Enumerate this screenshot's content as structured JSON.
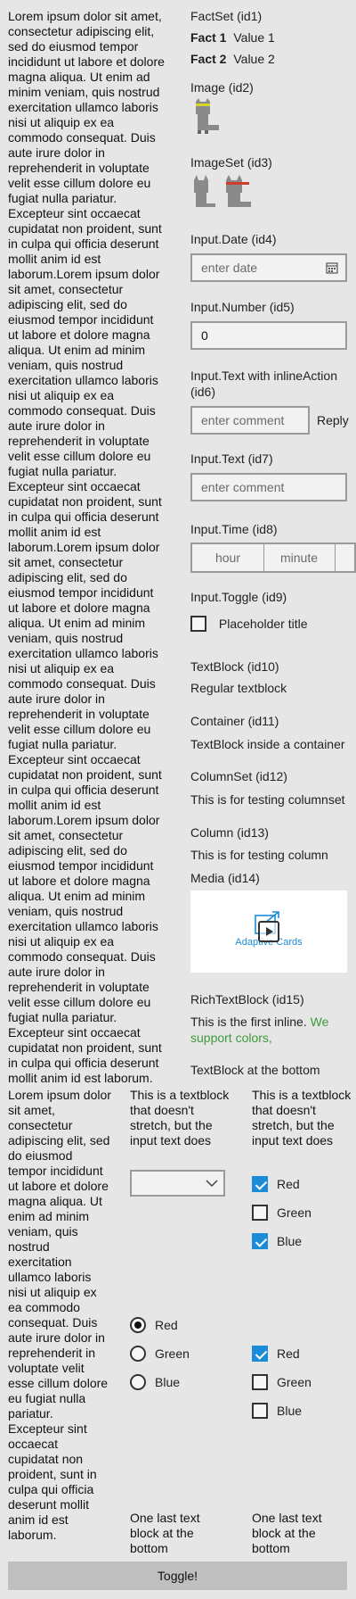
{
  "left_text": "Lorem ipsum dolor sit amet, consectetur adipiscing elit, sed do eiusmod tempor incididunt ut labore et dolore magna aliqua. Ut enim ad minim veniam, quis nostrud exercitation ullamco laboris nisi ut aliquip ex ea commodo consequat. Duis aute irure dolor in reprehenderit in voluptate velit esse cillum dolore eu fugiat nulla pariatur. Excepteur sint occaecat cupidatat non proident, sunt in culpa qui officia deserunt mollit anim id est laborum.Lorem ipsum dolor sit amet, consectetur adipiscing elit, sed do eiusmod tempor incididunt ut labore et dolore magna aliqua. Ut enim ad minim veniam, quis nostrud exercitation ullamco laboris nisi ut aliquip ex ea commodo consequat. Duis aute irure dolor in reprehenderit in voluptate velit esse cillum dolore eu fugiat nulla pariatur. Excepteur sint occaecat cupidatat non proident, sunt in culpa qui officia deserunt mollit anim id est laborum.Lorem ipsum dolor sit amet, consectetur adipiscing elit, sed do eiusmod tempor incididunt ut labore et dolore magna aliqua. Ut enim ad minim veniam, quis nostrud exercitation ullamco laboris nisi ut aliquip ex ea commodo consequat. Duis aute irure dolor in reprehenderit in voluptate velit esse cillum dolore eu fugiat nulla pariatur. Excepteur sint occaecat cupidatat non proident, sunt in culpa qui officia deserunt mollit anim id est laborum.Lorem ipsum dolor sit amet, consectetur adipiscing elit, sed do eiusmod tempor incididunt ut labore et dolore magna aliqua. Ut enim ad minim veniam, quis nostrud exercitation ullamco laboris nisi ut aliquip ex ea commodo consequat. Duis aute irure dolor in reprehenderit in voluptate velit esse cillum dolore eu fugiat nulla pariatur. Excepteur sint occaecat cupidatat non proident, sunt in culpa qui officia deserunt mollit anim id est laborum.",
  "right": {
    "factset_label": "FactSet (id1)",
    "facts": [
      {
        "title": "Fact 1",
        "value": "Value 1"
      },
      {
        "title": "Fact 2",
        "value": "Value 2"
      }
    ],
    "image_label": "Image (id2)",
    "imageset_label": "ImageSet (id3)",
    "date_label": "Input.Date (id4)",
    "date_placeholder": "enter date",
    "number_label": "Input.Number (id5)",
    "number_value": "0",
    "inline_label": "Input.Text with inlineAction (id6)",
    "inline_placeholder": "enter comment",
    "inline_action": "Reply",
    "text_label": "Input.Text (id7)",
    "text_placeholder": "enter comment",
    "time_label": "Input.Time (id8)",
    "time_hour": "hour",
    "time_minute": "minute",
    "toggle_label": "Input.Toggle (id9)",
    "toggle_title": "Placeholder title",
    "textblock_label": "TextBlock (id10)",
    "textblock_value": "Regular textblock",
    "container_label": "Container (id11)",
    "container_value": "TextBlock inside a container",
    "columnset_label": "ColumnSet (id12)",
    "columnset_value": "This is for testing columnset",
    "column_label": "Column (id13)",
    "column_value": "This is for testing column",
    "media_label": "Media (id14)",
    "media_caption": "Adaptive Cards",
    "richtext_label": "RichTextBlock (id15)",
    "richtext_plain": "This is the first inline.",
    "richtext_colored": "We support colors,",
    "richtext_color": "#3c9a3c",
    "bottom_text": "TextBlock at the bottom"
  },
  "bottom": {
    "col1_text": "Lorem ipsum dolor sit amet, consectetur adipiscing elit, sed do eiusmod tempor incididunt ut labore et dolore magna aliqua. Ut enim ad minim veniam, quis nostrud exercitation ullamco laboris nisi ut aliquip ex ea commodo consequat. Duis aute irure dolor in reprehenderit in voluptate velit esse cillum dolore eu fugiat nulla pariatur. Excepteur sint occaecat cupidatat non proident, sunt in culpa qui officia deserunt mollit anim id est laborum.",
    "col2_top": "This is a textblock that doesn't stretch, but the input text does",
    "col3_top": "This is a textblock that doesn't stretch, but the input text does",
    "col3_checks": [
      {
        "label": "Red",
        "checked": true
      },
      {
        "label": "Green",
        "checked": false
      },
      {
        "label": "Blue",
        "checked": true
      }
    ],
    "col2_radios": [
      {
        "label": "Red",
        "checked": true
      },
      {
        "label": "Green",
        "checked": false
      },
      {
        "label": "Blue",
        "checked": false
      }
    ],
    "col3_checks2": [
      {
        "label": "Red",
        "checked": true
      },
      {
        "label": "Green",
        "checked": false
      },
      {
        "label": "Blue",
        "checked": false
      }
    ],
    "col2_bottom": "One last text block at the bottom",
    "col3_bottom": "One last text block at the bottom",
    "toggle_button": "Toggle!"
  },
  "colors": {
    "accent": "#1a8cd8",
    "media_accent": "#1a8cd8"
  }
}
